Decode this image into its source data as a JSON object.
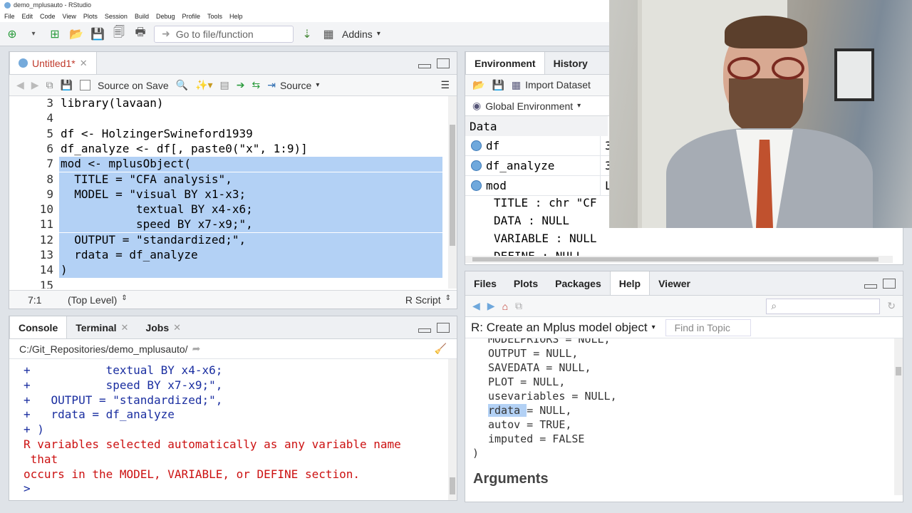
{
  "window": {
    "title": "demo_mplusauto - RStudio"
  },
  "menu": [
    "File",
    "Edit",
    "Code",
    "View",
    "Plots",
    "Session",
    "Build",
    "Debug",
    "Profile",
    "Tools",
    "Help"
  ],
  "toolbar": {
    "goto_placeholder": "Go to file/function",
    "addins": "Addins"
  },
  "editor": {
    "tab": "Untitled1*",
    "source_on_save": "Source on Save",
    "source_label": "Source",
    "status_pos": "7:1",
    "status_scope": "(Top Level)",
    "status_type": "R Script",
    "lines": [
      {
        "n": "3",
        "text": "library(lavaan)",
        "selected": false
      },
      {
        "n": "4",
        "text": "",
        "selected": false
      },
      {
        "n": "5",
        "text": "df <- HolzingerSwineford1939",
        "selected": false
      },
      {
        "n": "6",
        "text": "df_analyze <- df[, paste0(\"x\", 1:9)]",
        "selected": false
      },
      {
        "n": "7",
        "text": "mod <- mplusObject(",
        "selected": true
      },
      {
        "n": "8",
        "text": "  TITLE = \"CFA analysis\",",
        "selected": true
      },
      {
        "n": "9",
        "text": "  MODEL = \"visual BY x1-x3;",
        "selected": true
      },
      {
        "n": "10",
        "text": "           textual BY x4-x6;",
        "selected": true
      },
      {
        "n": "11",
        "text": "           speed BY x7-x9;\",",
        "selected": true
      },
      {
        "n": "12",
        "text": "  OUTPUT = \"standardized;\",",
        "selected": true
      },
      {
        "n": "13",
        "text": "  rdata = df_analyze",
        "selected": true
      },
      {
        "n": "14",
        "text": ")",
        "selected": true
      },
      {
        "n": "15",
        "text": "",
        "selected": false
      }
    ]
  },
  "console": {
    "tabs": [
      "Console",
      "Terminal",
      "Jobs"
    ],
    "path": "C:/Git_Repositories/demo_mplusauto/",
    "lines": [
      {
        "text": "+           textual BY x4-x6;",
        "style": "blue"
      },
      {
        "text": "+           speed BY x7-x9;\",",
        "style": "blue"
      },
      {
        "text": "+   OUTPUT = \"standardized;\",",
        "style": "blue"
      },
      {
        "text": "+   rdata = df_analyze",
        "style": "blue"
      },
      {
        "text": "+ )",
        "style": "blue"
      },
      {
        "text": "R variables selected automatically as any variable name",
        "style": "red"
      },
      {
        "text": " that",
        "style": "red"
      },
      {
        "text": "occurs in the MODEL, VARIABLE, or DEFINE section.",
        "style": "red"
      },
      {
        "text": "> ",
        "style": "blue"
      }
    ]
  },
  "environment": {
    "tabs": [
      "Environment",
      "History"
    ],
    "import_label": "Import Dataset",
    "scope": "Global Environment",
    "section": "Data",
    "rows": [
      {
        "name": "df",
        "value": "3"
      },
      {
        "name": "df_analyze",
        "value": "3"
      },
      {
        "name": "mod",
        "value": "L"
      }
    ],
    "mod_children": [
      "TITLE : chr \"CF",
      "DATA : NULL",
      "VARIABLE : NULL",
      "DEFINE : NULL"
    ]
  },
  "help": {
    "tabs": [
      "Files",
      "Plots",
      "Packages",
      "Help",
      "Viewer"
    ],
    "topic_title": "R: Create an Mplus model object",
    "find_placeholder": "Find in Topic",
    "lines": [
      "MODELPRIORS = NULL,",
      "OUTPUT = NULL,",
      "SAVEDATA = NULL,",
      "PLOT = NULL,",
      "usevariables = NULL,",
      "rdata = NULL,",
      "autov = TRUE,",
      "imputed = FALSE"
    ],
    "highlight": "rdata",
    "close_paren": ")",
    "heading": "Arguments"
  }
}
